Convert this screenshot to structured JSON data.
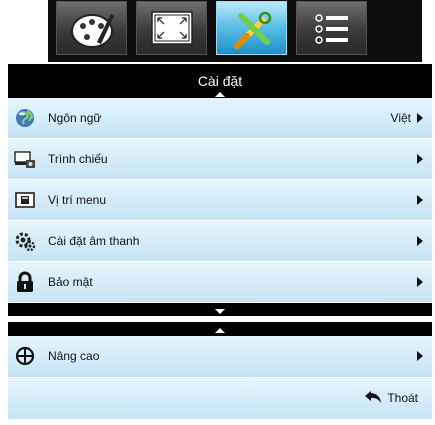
{
  "tabs": [
    {
      "icon": "palette-icon",
      "active": false
    },
    {
      "icon": "screen-corners-icon",
      "active": false
    },
    {
      "icon": "tools-icon",
      "active": true
    },
    {
      "icon": "list-options-icon",
      "active": false
    }
  ],
  "menu": {
    "title": "Cài đặt",
    "items": [
      {
        "label": "Ngôn ngữ",
        "value": "Việt",
        "icon": "globe-icon"
      },
      {
        "label": "Trình chiếu",
        "value": "",
        "icon": "projection-icon"
      },
      {
        "label": "Vị trí menu",
        "value": "",
        "icon": "menu-position-icon"
      },
      {
        "label": "Cài đặt âm thanh",
        "value": "",
        "icon": "audio-settings-icon"
      },
      {
        "label": "Bảo mật",
        "value": "",
        "icon": "lock-icon"
      }
    ]
  },
  "advanced": {
    "label": "Nâng cao",
    "icon": "plus-circle-icon",
    "exit_label": "Thoát",
    "exit_icon": "return-arrow-icon"
  },
  "colors": {
    "active_tab": "#5fc0e8",
    "row_background": "#d4ecf8",
    "panel_background": "#000000"
  }
}
